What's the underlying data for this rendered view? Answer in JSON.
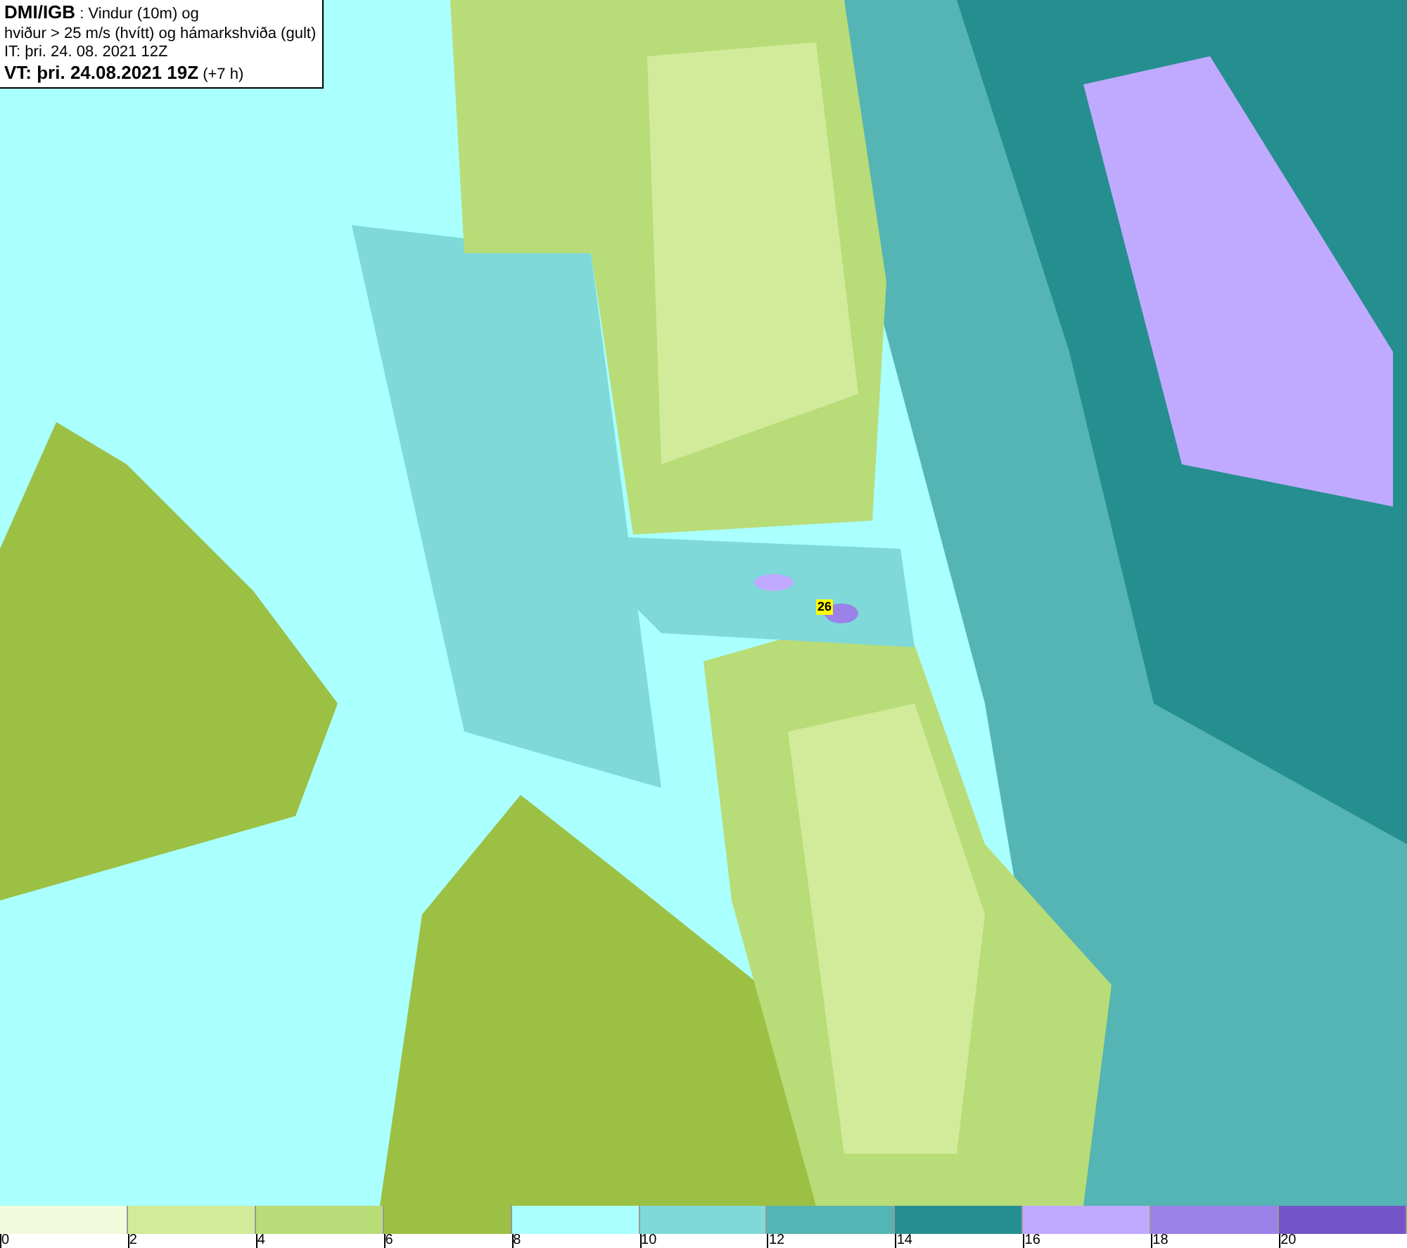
{
  "header": {
    "source": "DMI/IGB",
    "title_rest": " : Vindur (10m) og",
    "subtitle": "hviður > 25 m/s (hvítt) og hámarkshviða (gult)",
    "issue_time": "IT: þri. 24. 08. 2021 12Z",
    "valid_label": "VT: þri. 24.08.2021 19Z",
    "valid_offset": " (+7 h)"
  },
  "map": {
    "gust_labels": [
      "26"
    ]
  },
  "legend": {
    "swatches": [
      {
        "color": "#f2fadc"
      },
      {
        "color": "#d2eb9a"
      },
      {
        "color": "#b8dc78"
      },
      {
        "color": "#9cc044"
      },
      {
        "color": "#aaffff"
      },
      {
        "color": "#7fd9d9"
      },
      {
        "color": "#55b4b4"
      },
      {
        "color": "#258f8f"
      },
      {
        "color": "#c0aaff"
      },
      {
        "color": "#9b82e8"
      },
      {
        "color": "#7355c8"
      }
    ],
    "ticks": [
      "0",
      "2",
      "4",
      "6",
      "8",
      "10",
      "12",
      "14",
      "16",
      "18",
      "20"
    ]
  }
}
